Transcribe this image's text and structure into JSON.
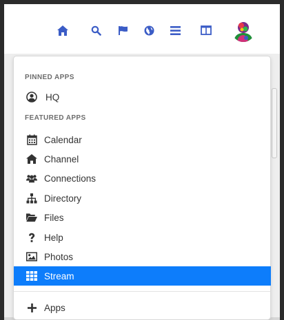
{
  "colors": {
    "nav_icon": "#3b5cc6",
    "active_bg": "#0d7dfb",
    "menu_icon": "#333333",
    "header_text": "#6c6c6c"
  },
  "navbar": {
    "icons": [
      "home-icon",
      "search-icon",
      "flag-icon",
      "globe-icon",
      "menu-bars-icon",
      "columns-icon"
    ],
    "avatar": "user-avatar"
  },
  "dropdown": {
    "pinned_header": "PINNED APPS",
    "pinned_items": [
      {
        "label": "HQ",
        "icon": "user-circle-icon"
      }
    ],
    "featured_header": "FEATURED APPS",
    "featured_items": [
      {
        "label": "Calendar",
        "icon": "calendar-icon"
      },
      {
        "label": "Channel",
        "icon": "home-icon"
      },
      {
        "label": "Connections",
        "icon": "users-icon"
      },
      {
        "label": "Directory",
        "icon": "sitemap-icon"
      },
      {
        "label": "Files",
        "icon": "folder-open-icon"
      },
      {
        "label": "Help",
        "icon": "question-icon"
      },
      {
        "label": "Photos",
        "icon": "image-icon"
      },
      {
        "label": "Stream",
        "icon": "grid-icon",
        "active": true
      }
    ],
    "footer_item": {
      "label": "Apps",
      "icon": "plus-icon"
    }
  }
}
